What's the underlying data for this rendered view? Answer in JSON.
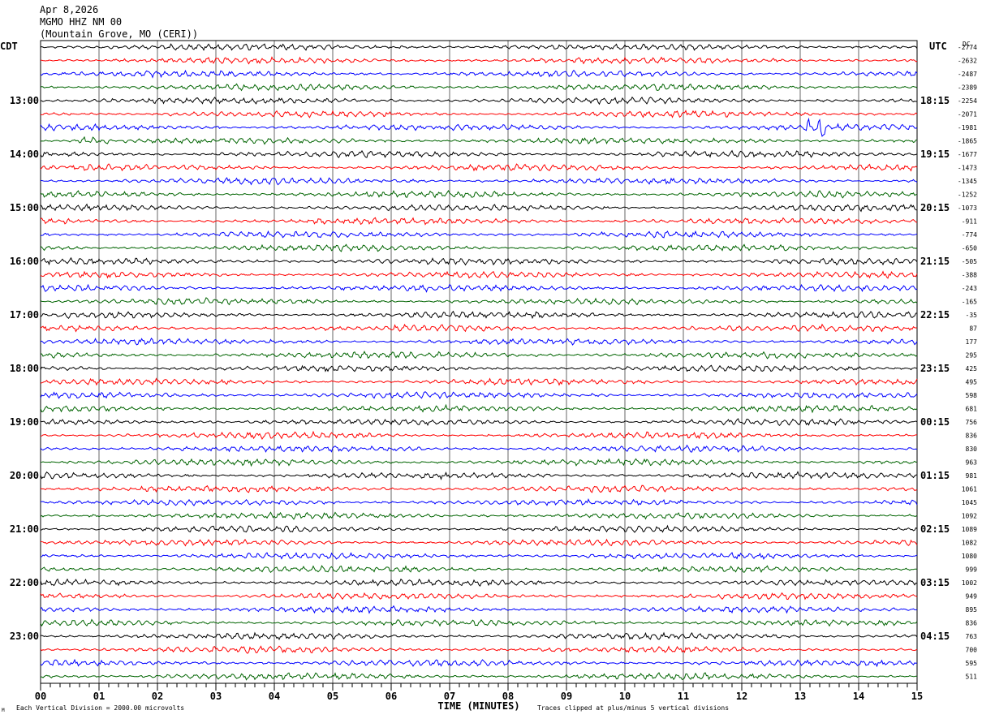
{
  "header": {
    "date": "Apr 8,2026",
    "station": "MGMO HHZ NM 00",
    "location": "(Mountain Grove, MO (CERI))"
  },
  "chart_data": {
    "type": "line",
    "subtype": "helicorder",
    "left_timezone": "CDT",
    "right_timezone": "UTC",
    "dc_label": "DC",
    "left_hour_labels": [
      "13:00",
      "14:00",
      "15:00",
      "16:00",
      "17:00",
      "18:00",
      "19:00",
      "20:00",
      "21:00",
      "22:00",
      "23:00"
    ],
    "right_hour_labels": [
      "18:15",
      "19:15",
      "20:15",
      "21:15",
      "22:15",
      "23:15",
      "00:15",
      "01:15",
      "02:15",
      "03:15",
      "04:15"
    ],
    "hour_label_rows": [
      4,
      8,
      12,
      16,
      20,
      24,
      28,
      32,
      36,
      40,
      44
    ],
    "dc_offsets": [
      -2774,
      -2632,
      -2487,
      -2389,
      -2254,
      -2071,
      -1981,
      -1865,
      -1677,
      -1473,
      -1345,
      -1252,
      -1073,
      -911,
      -774,
      -650,
      -505,
      -388,
      -243,
      -165,
      -35,
      87,
      177,
      295,
      425,
      495,
      598,
      681,
      756,
      836,
      830,
      963,
      981,
      1061,
      1045,
      1092,
      1089,
      1082,
      1080,
      999,
      1002,
      949,
      895,
      836,
      763,
      700,
      595,
      511
    ],
    "trace_colors": [
      "#000000",
      "#ff0000",
      "#0000ff",
      "#006400"
    ],
    "x_ticks": [
      "00",
      "01",
      "02",
      "03",
      "04",
      "05",
      "06",
      "07",
      "08",
      "09",
      "10",
      "11",
      "12",
      "13",
      "14",
      "15"
    ],
    "xlim": [
      0,
      15
    ],
    "xlabel": "TIME (MINUTES)",
    "grid": true,
    "events": [
      {
        "row": 6,
        "start_min": 13.1,
        "end_min": 13.45,
        "amplitude": "large"
      },
      {
        "row": 7,
        "start_min": 0.65,
        "end_min": 1.15,
        "amplitude": "medium"
      }
    ]
  },
  "footer": {
    "scale_note": "Each Vertical Division = 2000.00 microvolts",
    "clip_note": "Traces clipped at plus/minus 5 vertical divisions",
    "corner_mark": "M"
  }
}
